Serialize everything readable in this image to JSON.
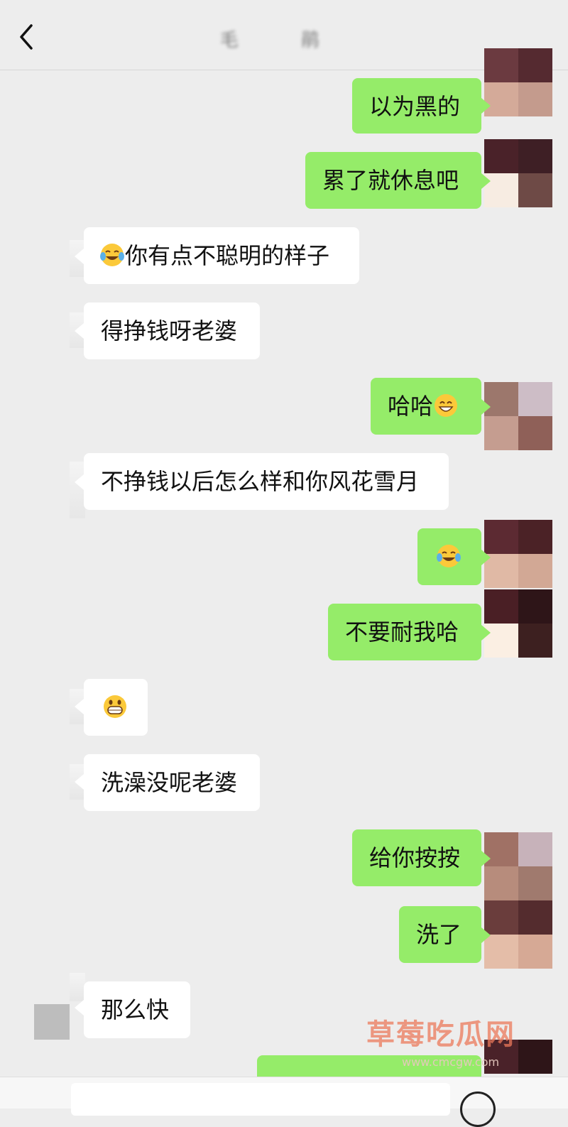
{
  "header": {
    "back_icon": "chevron-left-icon",
    "title": "毛 鹃"
  },
  "messages": [
    {
      "dir": "out",
      "text": "以为黑的"
    },
    {
      "dir": "out",
      "text": "累了就休息吧"
    },
    {
      "dir": "in",
      "emoji": "face-with-tears-of-joy",
      "text": "你有点不聪明的样子"
    },
    {
      "dir": "in",
      "text": "得挣钱呀老婆"
    },
    {
      "dir": "out",
      "text": "哈哈",
      "emoji_after": "grinning-face-with-smiling-eyes"
    },
    {
      "dir": "in",
      "text": "不挣钱以后怎么样和你风花雪月"
    },
    {
      "dir": "out",
      "emoji": "face-with-tears-of-joy",
      "text": ""
    },
    {
      "dir": "out",
      "text": "不要耐我哈"
    },
    {
      "dir": "in",
      "emoji": "grinning-face",
      "text": ""
    },
    {
      "dir": "in",
      "text": "洗澡没呢老婆"
    },
    {
      "dir": "out",
      "text": "给你按按"
    },
    {
      "dir": "out",
      "text": "洗了"
    },
    {
      "dir": "in",
      "text": "那么快"
    }
  ],
  "watermark": {
    "text": "草莓吃瓜网",
    "url": "www.cmcgw.com"
  },
  "colors": {
    "background": "#ededed",
    "outgoing_bubble": "#95ec69",
    "incoming_bubble": "#ffffff"
  }
}
